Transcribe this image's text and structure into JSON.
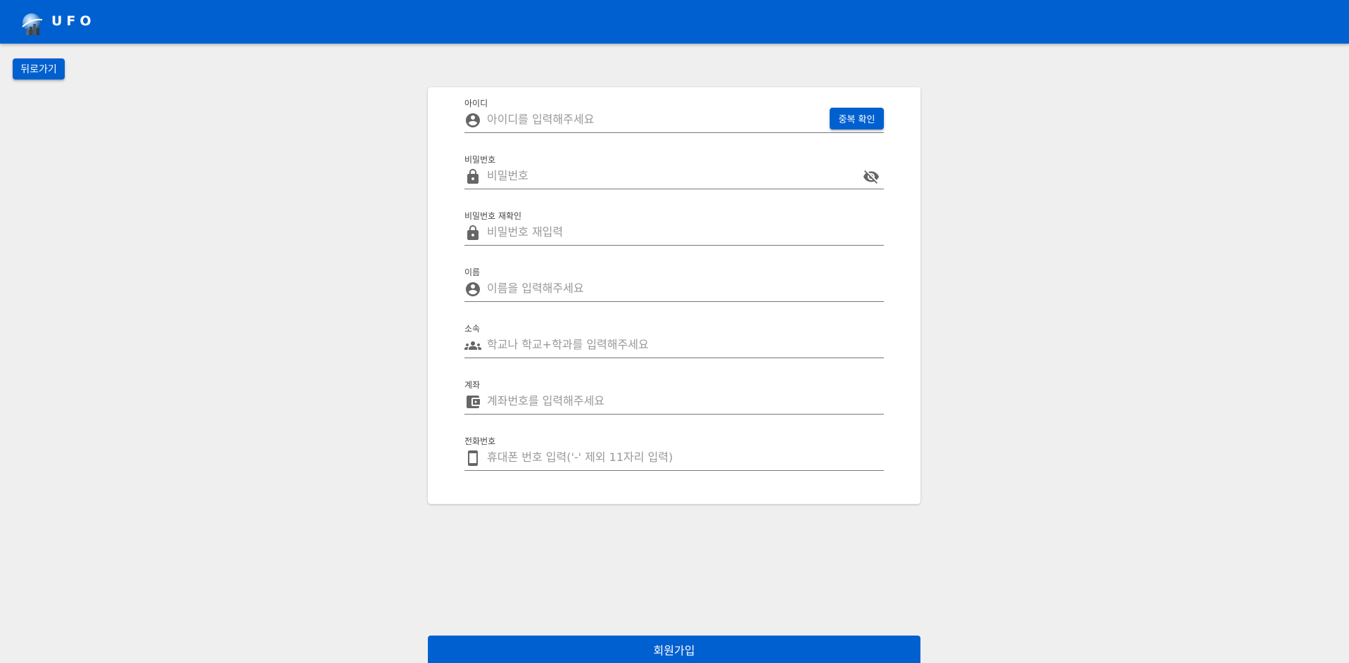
{
  "header": {
    "brand": "UFO",
    "color": "#0060d0"
  },
  "nav": {
    "back_label": "뒤로가기"
  },
  "form": {
    "fields": [
      {
        "label": "아이디",
        "placeholder": "아이디를 입력해주세요",
        "value": "",
        "icon": "account-circle-icon",
        "action_label": "중복 확인"
      },
      {
        "label": "비밀번호",
        "placeholder": "비밀번호",
        "value": "",
        "icon": "lock-icon",
        "toggle_icon": "visibility-off-icon"
      },
      {
        "label": "비밀번호 재확인",
        "placeholder": "비밀번호 재입력",
        "value": "",
        "icon": "lock-icon"
      },
      {
        "label": "이름",
        "placeholder": "이름을 입력해주세요",
        "value": "",
        "icon": "account-circle-icon"
      },
      {
        "label": "소속",
        "placeholder": "학교나 학교+학과를 입력해주세요",
        "value": "",
        "icon": "group-icon"
      },
      {
        "label": "계좌",
        "placeholder": "계좌번호를 입력해주세요",
        "value": "",
        "icon": "wallet-icon"
      },
      {
        "label": "전화번호",
        "placeholder": "휴대폰 번호 입력('-' 제외 11자리 입력)",
        "value": "",
        "icon": "smartphone-icon"
      }
    ],
    "submit_label": "회원가입"
  },
  "colors": {
    "primary": "#0060d0",
    "background": "#efefef",
    "icon": "#666666"
  }
}
